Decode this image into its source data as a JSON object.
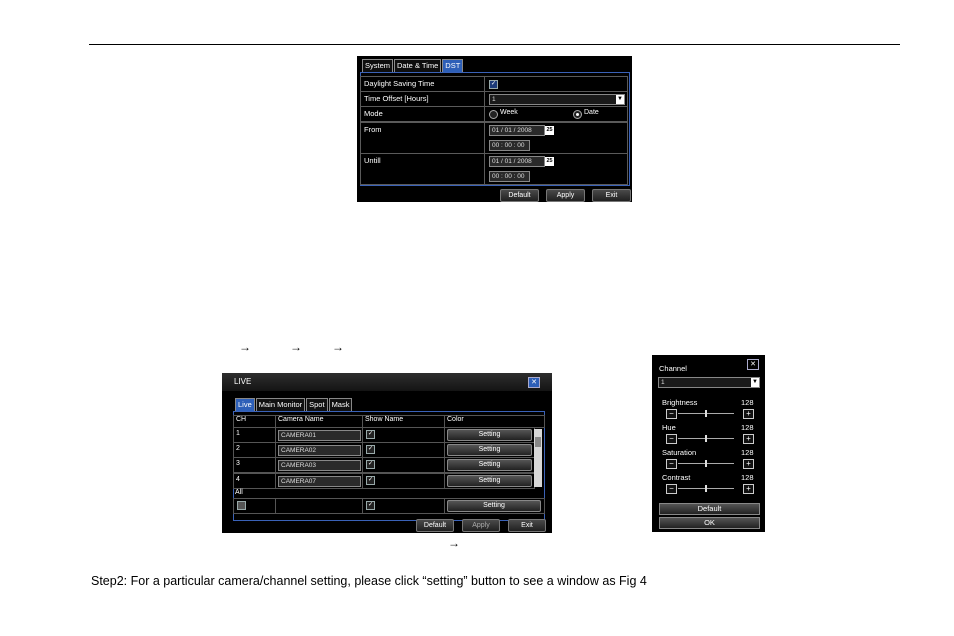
{
  "dst_dialog": {
    "tabs": [
      "System",
      "Date & Time",
      "DST"
    ],
    "rows": {
      "daylight_saving_time": "Daylight Saving Time",
      "time_offset": "Time Offset [Hours]",
      "time_offset_value": "1",
      "mode": "Mode",
      "mode_week": "Week",
      "mode_date": "Date",
      "from": "From",
      "from_date": "01 / 01 / 2008",
      "from_time": "00 : 00 : 00",
      "until": "Untill",
      "until_date": "01 / 01 / 2008",
      "until_time": "00 : 00 : 00"
    },
    "buttons": {
      "default": "Default",
      "apply": "Apply",
      "exit": "Exit"
    },
    "calendar_icon_text": "25",
    "checkbox_mark": "✓"
  },
  "arrows": [
    "→",
    "→",
    "→",
    "→"
  ],
  "live_dialog": {
    "title": "LIVE",
    "close": "✕",
    "tabs": [
      "Live",
      "Main Monitor",
      "Spot",
      "Mask"
    ],
    "columns": {
      "ch": "CH",
      "camera_name": "Camera Name",
      "show_name": "Show Name",
      "color": "Color"
    },
    "rows": [
      {
        "ch": "1",
        "name": "CAMERA01",
        "setting": "Setting"
      },
      {
        "ch": "2",
        "name": "CAMERA02",
        "setting": "Setting"
      },
      {
        "ch": "3",
        "name": "CAMERA03",
        "setting": "Setting"
      },
      {
        "ch": "4",
        "name": "CAMERA07",
        "setting": "Setting"
      }
    ],
    "all_label": "All",
    "all_setting": "Setting",
    "buttons": {
      "default": "Default",
      "apply": "Apply",
      "exit": "Exit"
    },
    "check": "✓"
  },
  "color_panel": {
    "close": "✕",
    "channel_label": "Channel",
    "channel_value": "1",
    "controls": [
      {
        "label": "Brightness",
        "value": "128",
        "level": 0.5
      },
      {
        "label": "Hue",
        "value": "128",
        "level": 0.5
      },
      {
        "label": "Saturation",
        "value": "128",
        "level": 0.5
      },
      {
        "label": "Contrast",
        "value": "128",
        "level": 0.5
      }
    ],
    "minus": "−",
    "plus": "+",
    "default": "Default",
    "ok": "OK"
  },
  "step_text": "Step2: For a particular camera/channel setting, please click “setting” button to see a window as Fig 4"
}
